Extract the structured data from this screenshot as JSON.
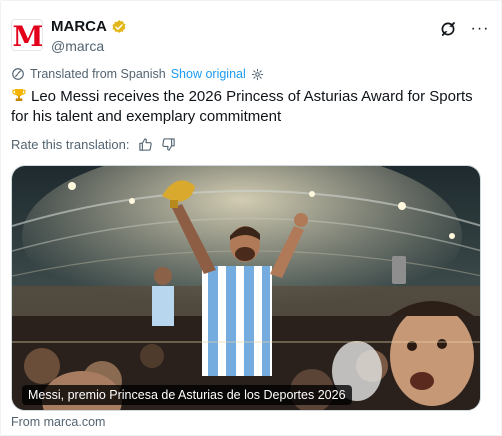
{
  "account": {
    "display_name": "MARCA",
    "handle": "@marca",
    "avatar_letter": "M",
    "brand_color": "#e2001a",
    "verified_color": "#e2b719"
  },
  "header_icons": [
    "grok-icon",
    "more-icon"
  ],
  "more_label": "···",
  "translation": {
    "translated_from": "Translated from Spanish",
    "show_original": "Show original",
    "link_color": "#1d9bf0"
  },
  "tweet": {
    "emoji": "trophy-icon",
    "text": "Leo Messi receives the 2026 Princess of Asturias Award for Sports for his talent and exemplary commitment"
  },
  "rate": {
    "label": "Rate this translation:",
    "icons": [
      "thumbs-up-icon",
      "thumbs-down-icon"
    ]
  },
  "media": {
    "caption": "Messi, premio Princesa de Asturias de los Deportes 2026"
  },
  "source": {
    "label": "From marca.com"
  }
}
